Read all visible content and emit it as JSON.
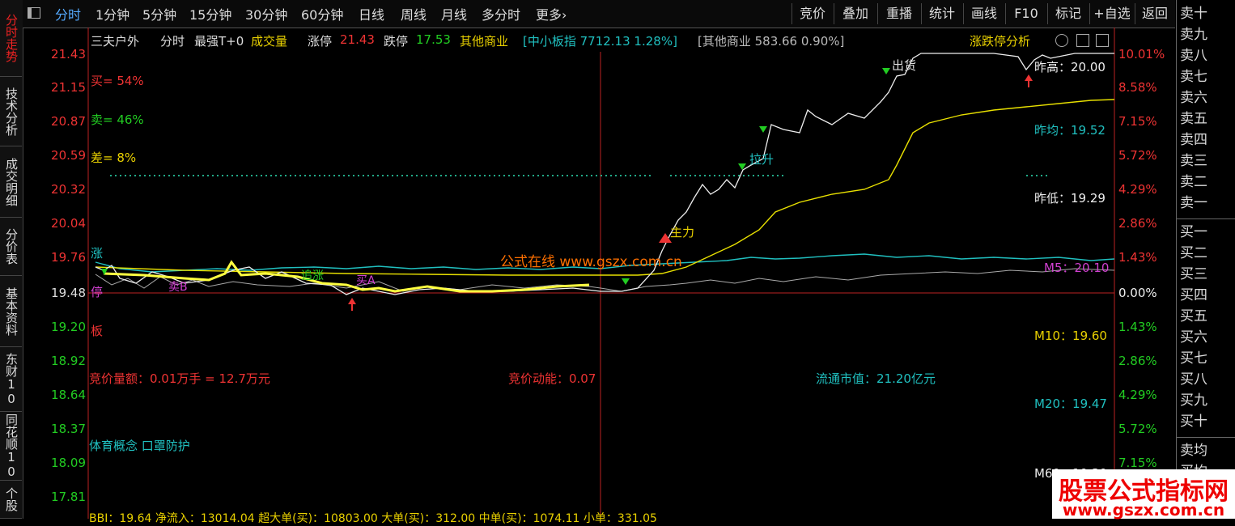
{
  "left_tabs": [
    "分时走势",
    "技术分析",
    "成交明细",
    "分价表",
    "基本资料",
    "东财10",
    "同花顺10",
    "个股"
  ],
  "toolbar": {
    "icon": "window-icon",
    "periods": [
      "分时",
      "1分钟",
      "5分钟",
      "15分钟",
      "30分钟",
      "60分钟",
      "日线",
      "周线",
      "月线",
      "多分时",
      "更多"
    ],
    "more_arrow": "›",
    "buttons": [
      "竞价",
      "叠加",
      "重播",
      "统计",
      "画线",
      "F10",
      "标记",
      "+自选",
      "返回"
    ]
  },
  "header": {
    "stock_name": "三夫户外",
    "mode": "分时",
    "indicator": "最强T+0",
    "volume_label": "成交量",
    "limit_up_label": "涨停",
    "limit_up_value": "21.43",
    "limit_down_label": "跌停",
    "limit_down_value": "17.53",
    "sector": "其他商业",
    "index_info": "[中小板指 7712.13 1.28%]",
    "sector_info": "[其他商业 583.66 0.90%]",
    "analysis_link": "涨跌停分析"
  },
  "y_axis_left": [
    "21.43",
    "21.15",
    "20.87",
    "20.59",
    "20.32",
    "20.04",
    "19.76",
    "19.48",
    "19.20",
    "18.92",
    "18.64",
    "18.37",
    "18.09",
    "17.81"
  ],
  "y_axis_right": [
    "10.01%",
    "8.58%",
    "7.15%",
    "5.72%",
    "4.29%",
    "2.86%",
    "1.43%",
    "0.00%",
    "1.43%",
    "2.86%",
    "4.29%",
    "5.72%",
    "7.15%"
  ],
  "stats": {
    "buy": "买= 54%",
    "sell": "卖= 46%",
    "diff": "差= 8%",
    "zhang": "涨",
    "ting": "停",
    "ban": "板"
  },
  "right_stats": {
    "prev_high": "昨高：20.00",
    "prev_avg": "昨均：19.52",
    "prev_low": "昨低：19.29",
    "m5": "M5：20.10",
    "m10": "M10：19.60",
    "m20": "M20：19.47",
    "m60": "M60：19.30"
  },
  "annotations": {
    "chase": "追涨",
    "buy_a": "买A",
    "sell_b": "卖B",
    "main_force": "主力",
    "pull_up": "拉升",
    "ship_out": "出货",
    "bid_amount": "竞价量额：0.01万手 = 12.7万元",
    "bid_momentum": "竞价动能：0.07",
    "float_cap": "流通市值：21.20亿元",
    "concepts": "体育概念 口罩防护",
    "site": "公式在线  www.gszx.com.cn",
    "bottom": "BBI：19.64    净流入：13014.04    超大单(买)：10803.00    大单(买)：312.00    中单(买)：1074.11    小单：331.05"
  },
  "order_book": {
    "sell": [
      "卖十",
      "卖九",
      "卖八",
      "卖七",
      "卖六",
      "卖五",
      "卖四",
      "卖三",
      "卖二",
      "卖一"
    ],
    "buy": [
      "买一",
      "买二",
      "买三",
      "买四",
      "买五",
      "买六",
      "买七",
      "买八",
      "买九",
      "买十"
    ],
    "sell_avg": "卖均",
    "buy_avg": "买均"
  },
  "watermark": {
    "line1": "股票公式指标网",
    "line2": "www.gszx.com.cn"
  },
  "colors": {
    "price": "#ffffff",
    "avg": "#e8e000",
    "index": "#20c0c0",
    "up": "#e33333",
    "down": "#22cc22"
  }
}
